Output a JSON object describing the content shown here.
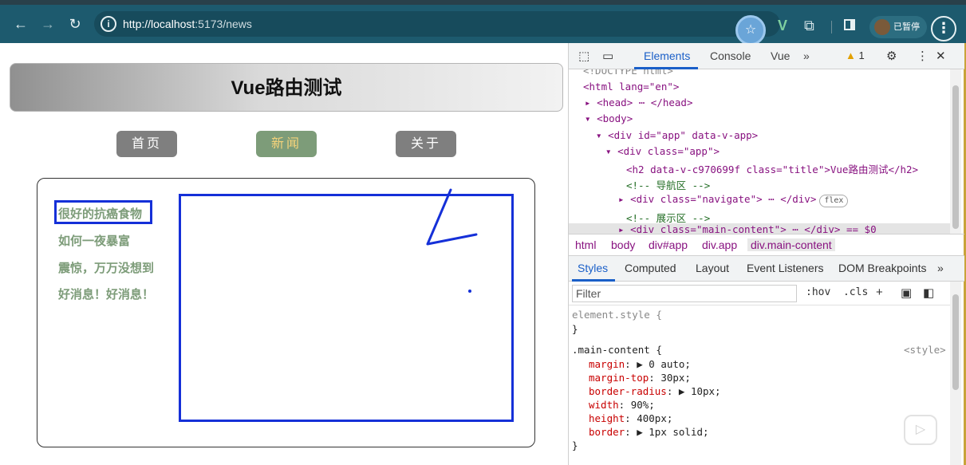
{
  "browser": {
    "url_host": "http://localhost",
    "url_rest": ":5173/news",
    "back_icon": "arrow-left",
    "forward_icon": "arrow-right",
    "reload_icon": "reload",
    "paused_label": "已暂停"
  },
  "page": {
    "title": "Vue路由测试",
    "nav": [
      "首页",
      "新闻",
      "关于"
    ],
    "news": [
      "很好的抗癌食物",
      "如何一夜暴富",
      "震惊，万万没想到",
      "好消息！好消息！"
    ]
  },
  "devtools": {
    "tabs": [
      "Elements",
      "Console",
      "Vue"
    ],
    "more": "»",
    "warnings": "1",
    "dom_lines": [
      "<!DOCTYPE html>",
      "<html lang=\"en\">",
      "<head> ⋯ </head>",
      "<body>",
      "<div id=\"app\" data-v-app>",
      "<div class=\"app\">",
      "<h2 data-v-c970699f class=\"title\">Vue路由测试</h2>",
      "<!-- 导航区 -->",
      "<div class=\"navigate\"> ⋯ </div>",
      "<!-- 展示区 -->",
      "<div class=\"main-content\"> ⋯ </div> == $0"
    ],
    "flex_badge": "flex",
    "breadcrumbs": [
      "html",
      "body",
      "div#app",
      "div.app",
      "div.main-content"
    ],
    "sub_tabs": [
      "Styles",
      "Computed",
      "Layout",
      "Event Listeners",
      "DOM Breakpoints"
    ],
    "filter_placeholder": "Filter",
    "filter_tools": ":hov  .cls",
    "style_rules": {
      "element_style": "element.style {",
      "close": "}",
      "selector": ".main-content {",
      "source": "<style>",
      "props": [
        {
          "name": "margin",
          "value": "▶ 0 auto;"
        },
        {
          "name": "margin-top",
          "value": "30px;"
        },
        {
          "name": "border-radius",
          "value": "▶ 10px;"
        },
        {
          "name": "width",
          "value": "90%;"
        },
        {
          "name": "height",
          "value": "400px;"
        },
        {
          "name": "border",
          "value": "▶ 1px solid;"
        }
      ]
    }
  }
}
